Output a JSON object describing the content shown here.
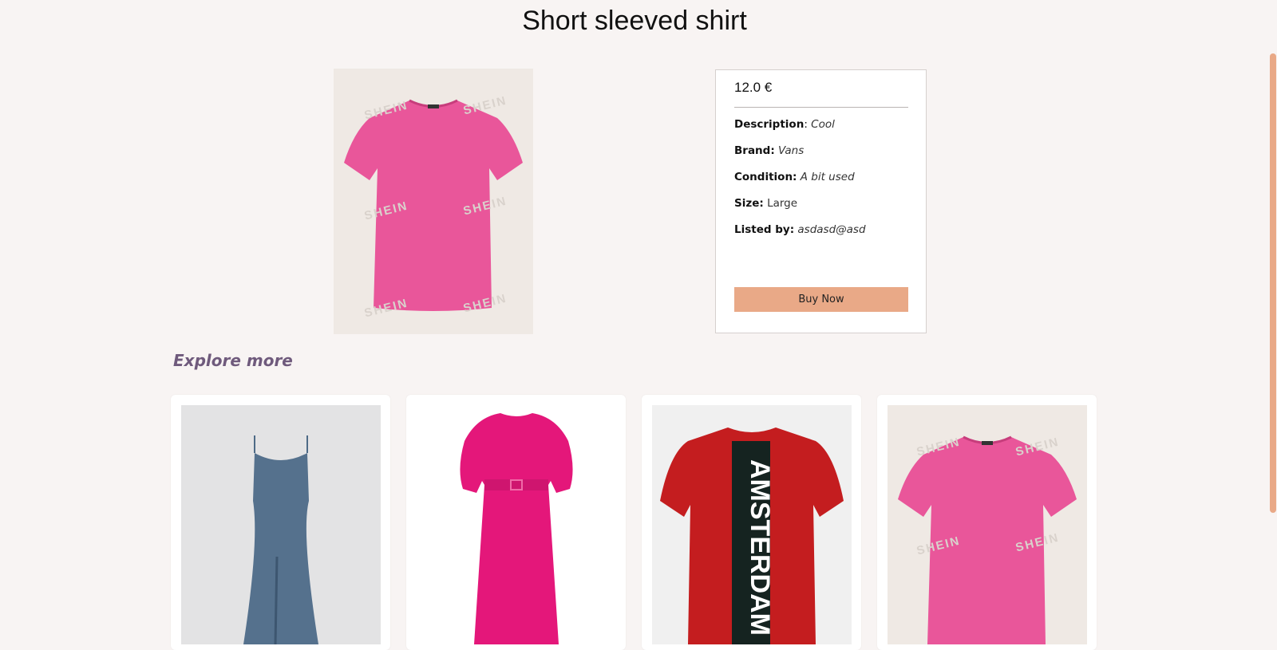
{
  "product": {
    "title": "Short sleeved shirt",
    "price": "12.0 €",
    "description_label": "Description",
    "description_value": "Cool",
    "brand_label": "Brand:",
    "brand_value": "Vans",
    "condition_label": "Condition:",
    "condition_value": "A bit used",
    "size_label": "Size:",
    "size_value": "Large",
    "listed_by_label": "Listed by:",
    "listed_by_value": "asdasd@asd",
    "buy_label": "Buy Now",
    "image_watermark": "SHEIN"
  },
  "explore": {
    "heading": "Explore more",
    "cards": [
      {
        "image": "blue-satin-slip-dress"
      },
      {
        "image": "pink-puff-sleeve-dress"
      },
      {
        "image": "red-amsterdam-tshirt",
        "print_text": "AMSTERDAM"
      },
      {
        "image": "pink-tshirt",
        "watermark": "SHEIN"
      }
    ]
  },
  "colors": {
    "accent": "#e9a987",
    "background": "#f8f4f3",
    "explore_heading": "#6f5a7c"
  }
}
